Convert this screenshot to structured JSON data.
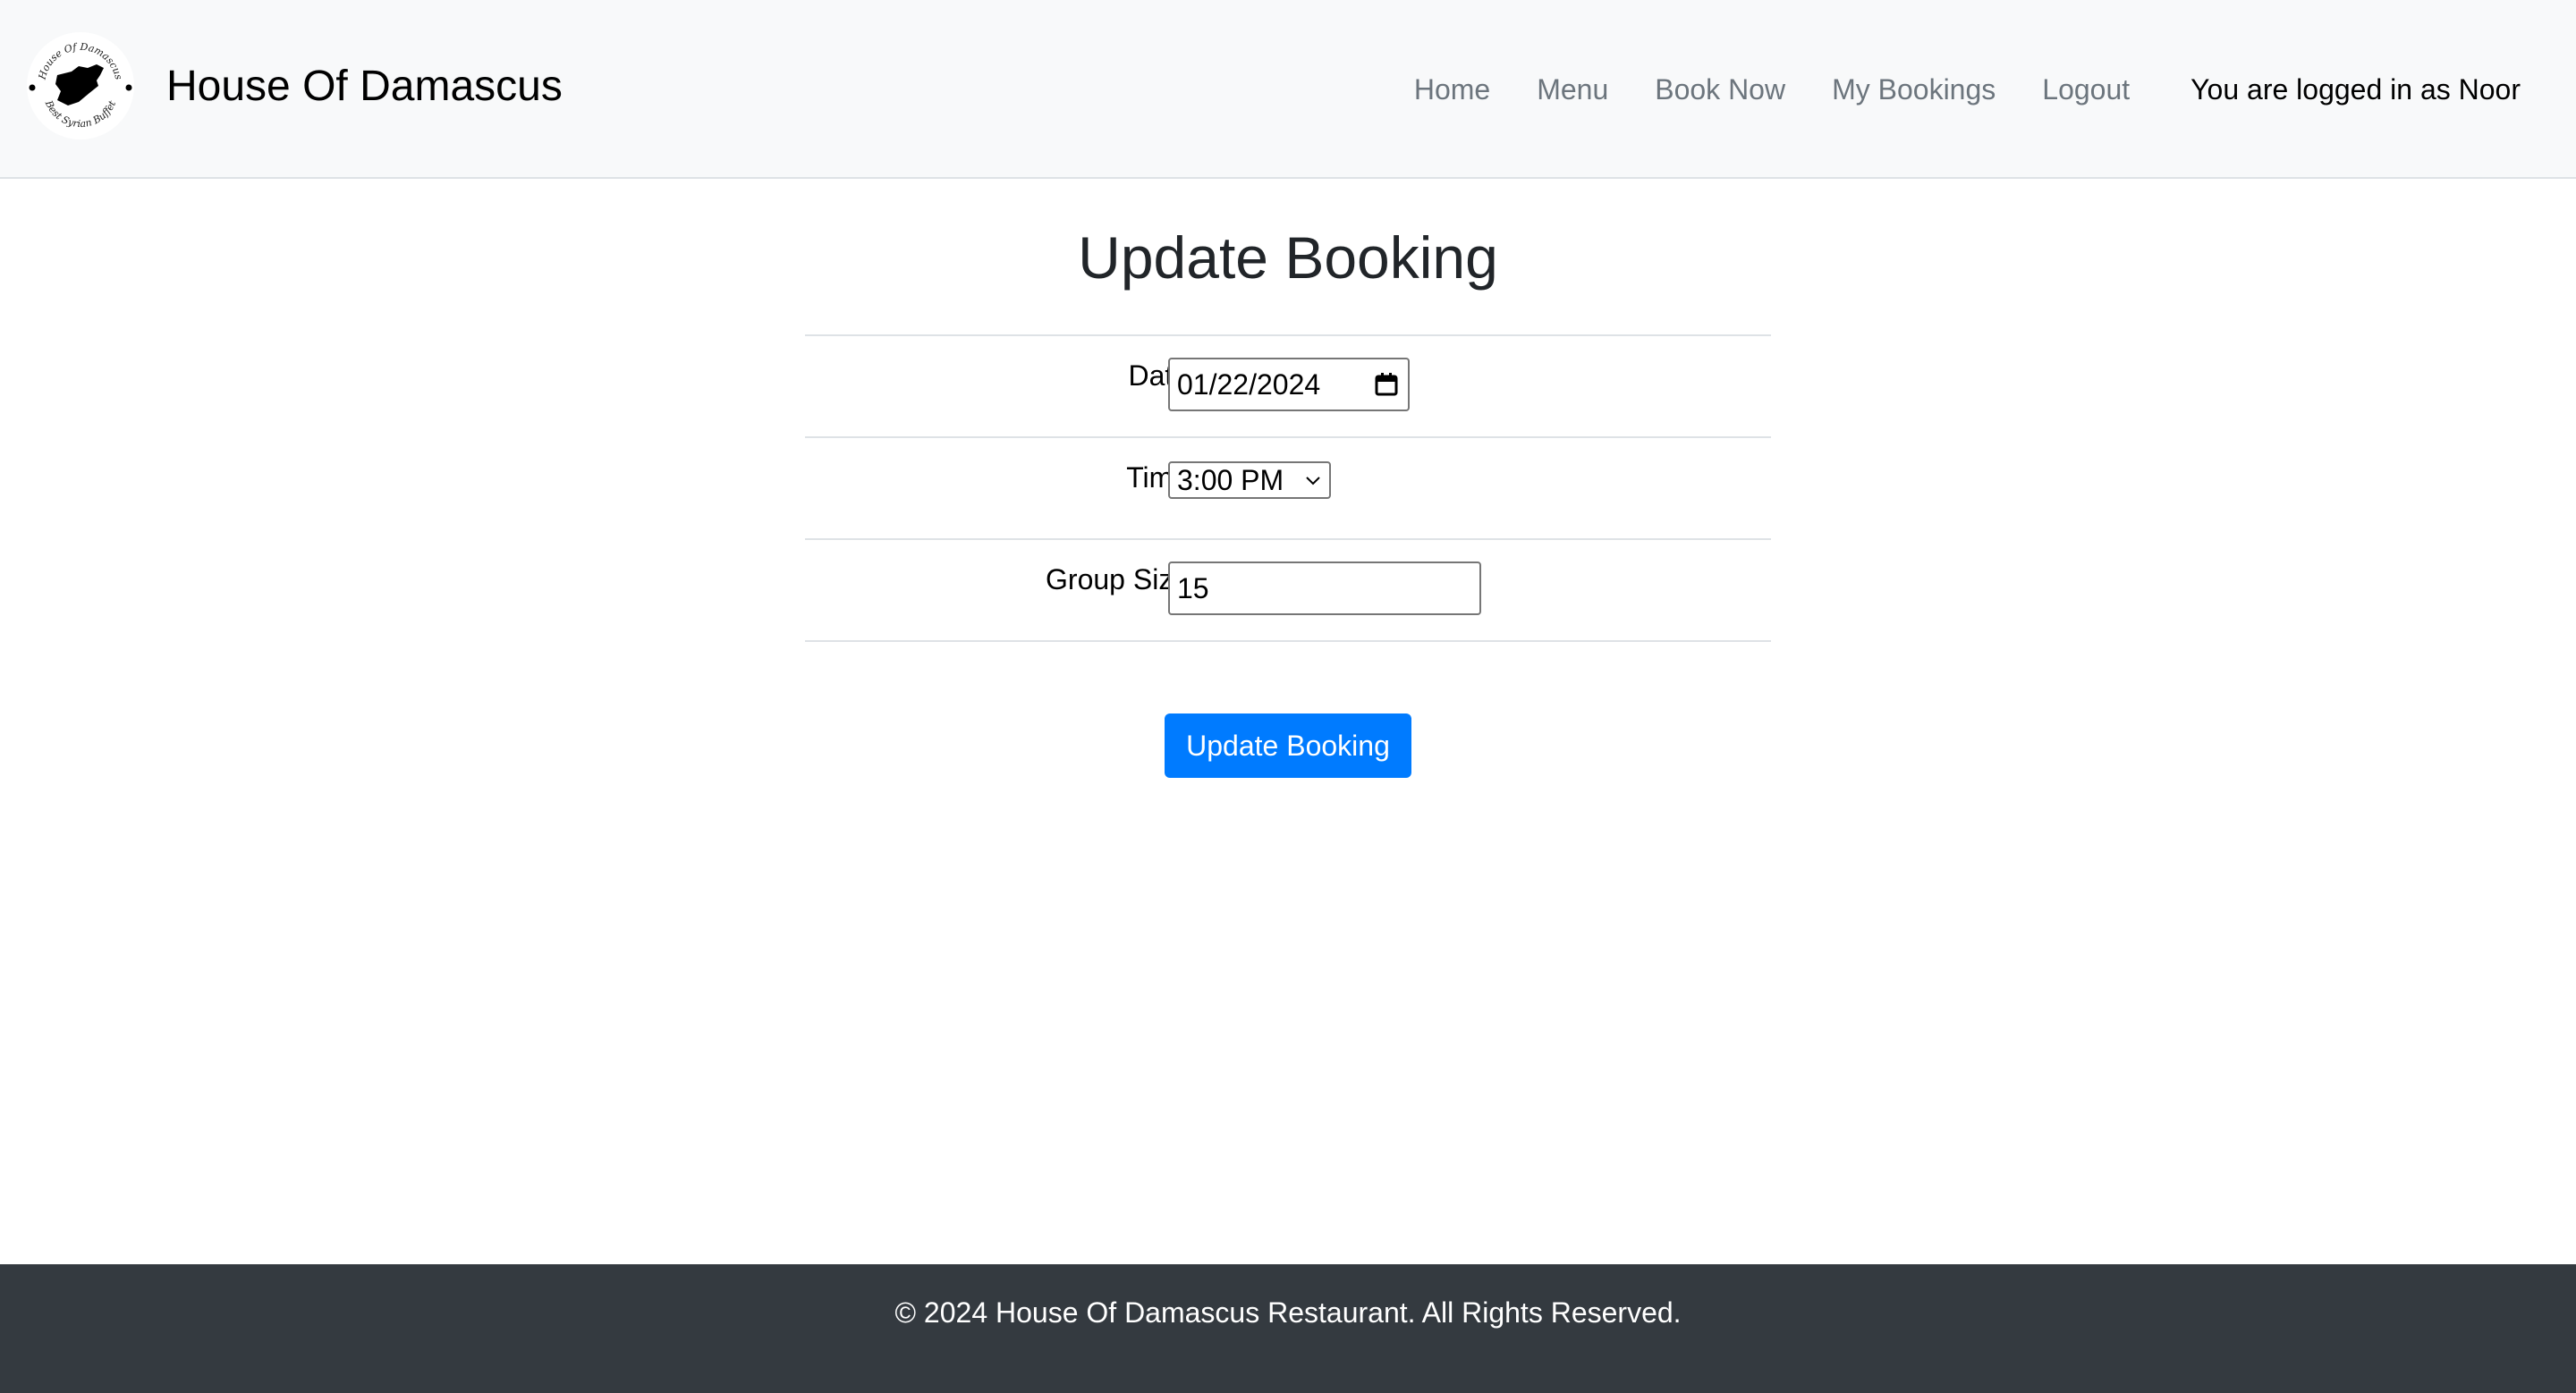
{
  "header": {
    "brand_name": "House Of Damascus",
    "logo": {
      "top_text": "House Of Damascus",
      "bottom_text": "Best Syrian Buffet",
      "icon": "syria-map-silhouette"
    },
    "nav": [
      {
        "label": "Home"
      },
      {
        "label": "Menu"
      },
      {
        "label": "Book Now"
      },
      {
        "label": "My Bookings"
      },
      {
        "label": "Logout"
      }
    ],
    "logged_in_text": "You are logged in as Noor"
  },
  "main": {
    "title": "Update Booking",
    "fields": {
      "date": {
        "label": "Date:",
        "value": "01/22/2024",
        "icon": "calendar-icon"
      },
      "time": {
        "label": "Time:",
        "value": "3:00 PM",
        "icon": "chevron-down-icon"
      },
      "group_size": {
        "label": "Group Size:",
        "value": "15"
      }
    },
    "submit_label": "Update Booking"
  },
  "footer": {
    "text": "© 2024 House Of Damascus Restaurant. All Rights Reserved."
  },
  "colors": {
    "primary": "#007bff",
    "navbar_bg": "#f8f9fa",
    "footer_bg": "#343a40",
    "nav_link": "#6c757d"
  }
}
